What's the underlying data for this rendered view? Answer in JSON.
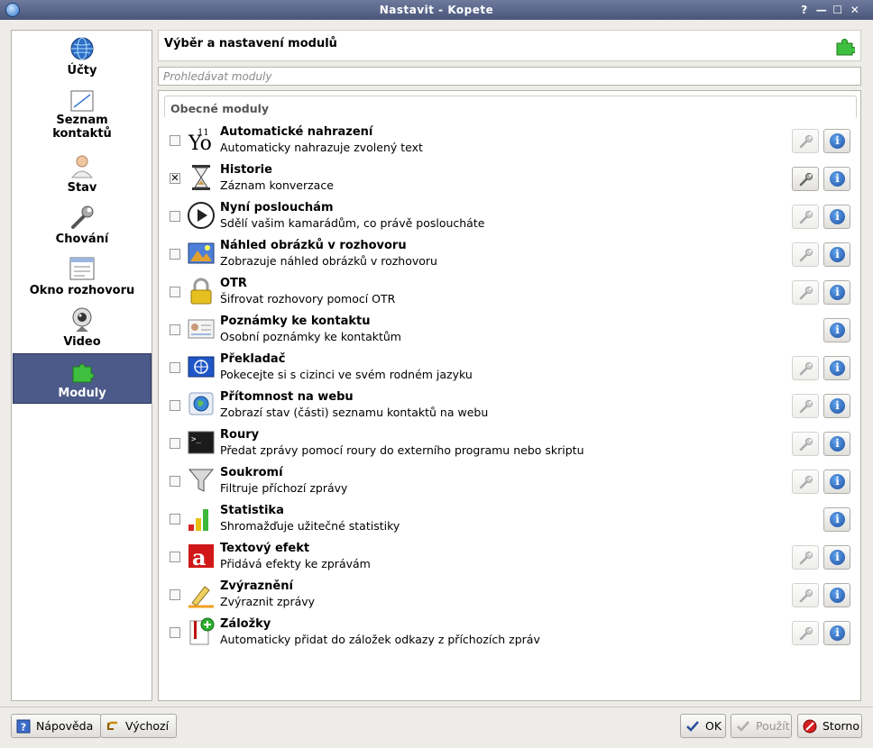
{
  "window": {
    "title": "Nastavit - Kopete",
    "help_btn": "?",
    "min_btn": "—",
    "max_btn": "☐",
    "close_btn": "✕"
  },
  "sidebar": {
    "items": [
      {
        "label": "Účty",
        "icon": "globe-icon"
      },
      {
        "label": "Seznam kontaktů",
        "icon": "contact-list-icon"
      },
      {
        "label": "Stav",
        "icon": "user-status-icon"
      },
      {
        "label": "Chování",
        "icon": "wrench-icon"
      },
      {
        "label": "Okno rozhovoru",
        "icon": "chat-window-icon"
      },
      {
        "label": "Video",
        "icon": "webcam-icon"
      },
      {
        "label": "Moduly",
        "icon": "puzzle-icon",
        "active": true
      }
    ]
  },
  "header": {
    "title": "Výběr a nastavení modulů",
    "icon": "puzzle-icon"
  },
  "search": {
    "placeholder": "Prohledávat moduly"
  },
  "group": {
    "title": "Obecné moduly"
  },
  "plugins": [
    {
      "name": "Automatické nahrazení",
      "desc": "Automaticky nahrazuje zvolený text",
      "checked": false,
      "configurable": true
    },
    {
      "name": "Historie",
      "desc": "Záznam konverzace",
      "checked": true,
      "configurable": true
    },
    {
      "name": "Nyní poslouchám",
      "desc": "Sdělí vašim kamarádům, co právě posloucháte",
      "checked": false,
      "configurable": true
    },
    {
      "name": "Náhled obrázků v rozhovoru",
      "desc": "Zobrazuje náhled obrázků v rozhovoru",
      "checked": false,
      "configurable": true
    },
    {
      "name": "OTR",
      "desc": "Šifrovat rozhovory pomocí OTR",
      "checked": false,
      "configurable": true
    },
    {
      "name": "Poznámky ke kontaktu",
      "desc": "Osobní poznámky ke kontaktům",
      "checked": false,
      "configurable": false
    },
    {
      "name": "Překladač",
      "desc": "Pokecejte si s cizinci ve svém rodném jazyku",
      "checked": false,
      "configurable": true
    },
    {
      "name": "Přítomnost na webu",
      "desc": "Zobrazí stav (části) seznamu kontaktů na webu",
      "checked": false,
      "configurable": true
    },
    {
      "name": "Roury",
      "desc": "Předat zprávy pomocí roury do externího programu nebo skriptu",
      "checked": false,
      "configurable": true
    },
    {
      "name": "Soukromí",
      "desc": "Filtruje příchozí zprávy",
      "checked": false,
      "configurable": true
    },
    {
      "name": "Statistika",
      "desc": "Shromažďuje užitečné statistiky",
      "checked": false,
      "configurable": false
    },
    {
      "name": "Textový efekt",
      "desc": "Přidává efekty ke zprávám",
      "checked": false,
      "configurable": true
    },
    {
      "name": "Zvýraznění",
      "desc": "Zvýraznit zprávy",
      "checked": false,
      "configurable": true
    },
    {
      "name": "Záložky",
      "desc": "Automaticky přidat do záložek odkazy z příchozích zpráv",
      "checked": false,
      "configurable": true
    }
  ],
  "plugin_icons": [
    "autoreplace-icon",
    "hourglass-icon",
    "play-icon",
    "image-preview-icon",
    "lock-icon",
    "contact-card-icon",
    "un-flag-icon",
    "web-globe-icon",
    "terminal-icon",
    "funnel-icon",
    "bar-chart-icon",
    "text-effect-icon",
    "highlighter-icon",
    "bookmark-add-icon"
  ],
  "buttons": {
    "help": "Nápověda",
    "defaults": "Výchozí",
    "ok": "OK",
    "apply": "Použít",
    "cancel": "Storno"
  },
  "colors": {
    "active_item": "#4c5a89",
    "titlebar": "#5a6789"
  }
}
